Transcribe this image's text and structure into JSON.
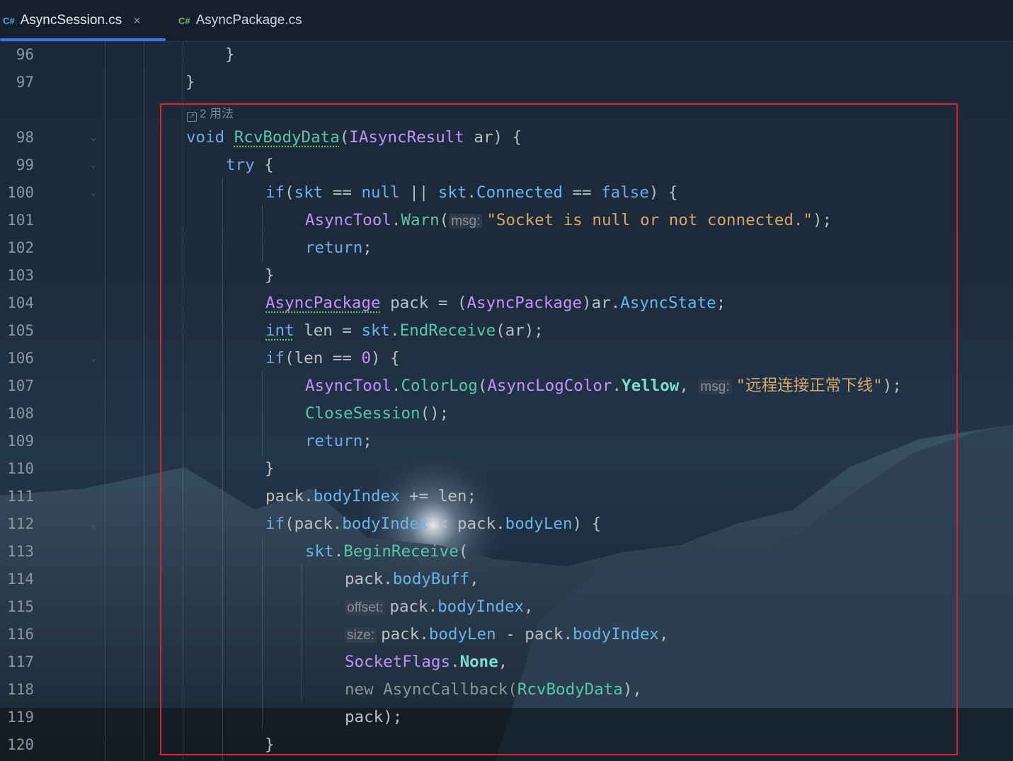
{
  "tabs": [
    {
      "lang": "C#",
      "label": "AsyncSession.cs",
      "close": "×"
    },
    {
      "lang": "C#",
      "label": "AsyncPackage.cs"
    }
  ],
  "usages_hint": "2 用法",
  "line_numbers": [
    "96",
    "97",
    "98",
    "99",
    "100",
    "101",
    "102",
    "103",
    "104",
    "105",
    "106",
    "107",
    "108",
    "109",
    "110",
    "111",
    "112",
    "113",
    "114",
    "115",
    "116",
    "117",
    "118",
    "119",
    "120"
  ],
  "code": {
    "l96": "}",
    "l97": "}",
    "l98": {
      "kw": "void",
      "fn": "RcvBodyData",
      "ty": "IAsyncResult",
      "arg": "ar"
    },
    "l99": "try",
    "l100": {
      "kw": "if",
      "a": "skt",
      "null": "null",
      "b": "skt",
      "prop": "Connected",
      "false": "false"
    },
    "l101": {
      "cls": "AsyncTool",
      "m": "Warn",
      "hint": "msg:",
      "str": "\"Socket is null or not connected.\""
    },
    "l102": "return",
    "l103": "}",
    "l104": {
      "ty": "AsyncPackage",
      "var": "pack",
      "ty2": "AsyncPackage",
      "obj": "ar",
      "prop": "AsyncState"
    },
    "l105": {
      "kw": "int",
      "var": "len",
      "obj": "skt",
      "m": "EndReceive",
      "arg": "ar"
    },
    "l106": {
      "kw": "if",
      "var": "len",
      "num": "0"
    },
    "l107": {
      "cls": "AsyncTool",
      "m": "ColorLog",
      "ty": "AsyncLogColor",
      "en": "Yellow",
      "hint": "msg:",
      "str": "\"远程连接正常下线\""
    },
    "l108": {
      "m": "CloseSession"
    },
    "l109": "return",
    "l110": "}",
    "l111": {
      "obj": "pack",
      "prop": "bodyIndex",
      "var": "len"
    },
    "l112": {
      "kw": "if",
      "obj": "pack",
      "prop": "bodyIndex",
      "obj2": "pack",
      "prop2": "bodyLen"
    },
    "l113": {
      "obj": "skt",
      "m": "BeginReceive"
    },
    "l114": {
      "obj": "pack",
      "prop": "bodyBuff"
    },
    "l115": {
      "hint": "offset:",
      "obj": "pack",
      "prop": "bodyIndex"
    },
    "l116": {
      "hint": "size:",
      "obj": "pack",
      "prop": "bodyLen",
      "obj2": "pack",
      "prop2": "bodyIndex"
    },
    "l117": {
      "ty": "SocketFlags",
      "en": "None"
    },
    "l118": {
      "kw": "new",
      "ty": "AsyncCallback",
      "fn": "RcvBodyData"
    },
    "l119": {
      "obj": "pack"
    },
    "l120": "}"
  },
  "colors": {
    "highlight_box": "#e0212b",
    "tab_underline": "#3574f0"
  }
}
